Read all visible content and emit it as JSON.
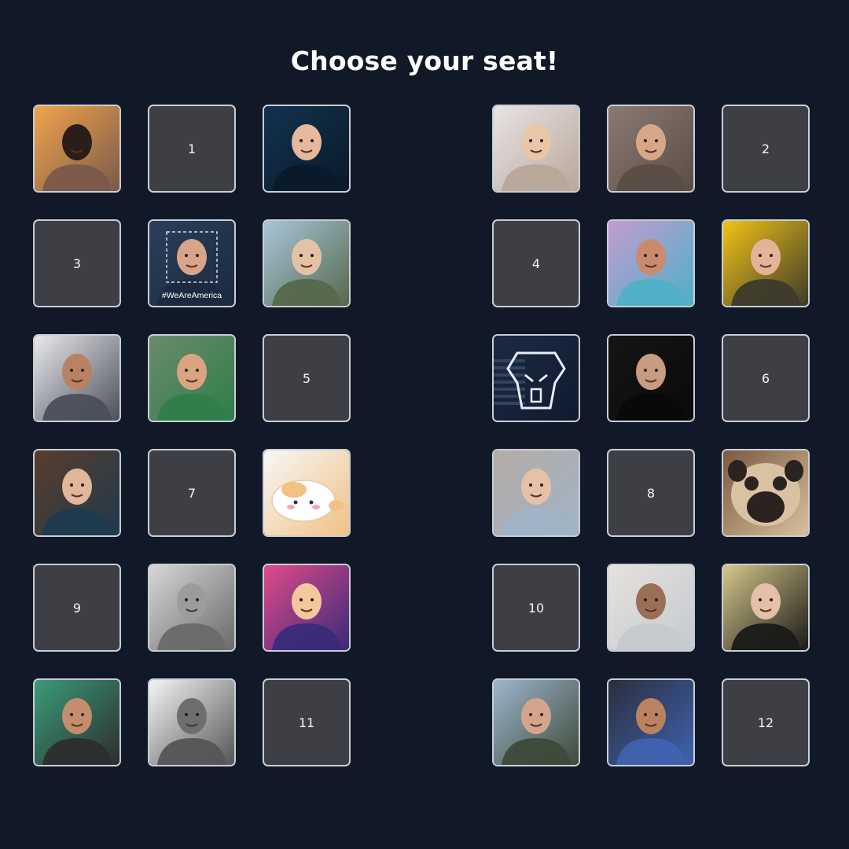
{
  "title": "Choose your seat!",
  "seats": [
    {
      "status": "taken",
      "avatar": "sunset-beach-woman-avatar",
      "colors": {
        "bg1": "#f0a34c",
        "bg2": "#7a5a4a",
        "fg": "#2a1d1a"
      }
    },
    {
      "status": "empty",
      "label": "1"
    },
    {
      "status": "taken",
      "avatar": "bald-bearded-man-avatar",
      "colors": {
        "bg1": "#12324f",
        "bg2": "#0a1a2a",
        "fg": "#e6b89c"
      }
    },
    {
      "status": "taken",
      "avatar": "blonde-woman-avatar",
      "colors": {
        "bg1": "#e8e3e5",
        "bg2": "#b9a79a",
        "fg": "#e8c6a8"
      }
    },
    {
      "status": "taken",
      "avatar": "smiling-man-hoodie-avatar",
      "colors": {
        "bg1": "#8a7a72",
        "bg2": "#5b4c45",
        "fg": "#d6a887"
      }
    },
    {
      "status": "empty",
      "label": "2"
    },
    {
      "status": "empty",
      "label": "3"
    },
    {
      "status": "taken",
      "avatar": "man-wearamerica-avatar",
      "colors": {
        "bg1": "#2c3e5b",
        "bg2": "#1b2a40",
        "fg": "#d9a58a"
      },
      "caption": "#WeAreAmerica"
    },
    {
      "status": "taken",
      "avatar": "man-glasses-camo-avatar",
      "colors": {
        "bg1": "#a9c6d8",
        "bg2": "#55684d",
        "fg": "#e3c3a6"
      }
    },
    {
      "status": "empty",
      "label": "4"
    },
    {
      "status": "taken",
      "avatar": "curly-hair-man-avatar",
      "colors": {
        "bg1": "#c39bd3",
        "bg2": "#4fb0c6",
        "fg": "#c98b6b"
      }
    },
    {
      "status": "taken",
      "avatar": "man-cap-yellow-avatar",
      "colors": {
        "bg1": "#f2c316",
        "bg2": "#3c3a2b",
        "fg": "#e3b49a"
      }
    },
    {
      "status": "taken",
      "avatar": "man-gray-hoodie-avatar",
      "colors": {
        "bg1": "#e9e9ec",
        "bg2": "#4a4f59",
        "fg": "#b98262"
      }
    },
    {
      "status": "taken",
      "avatar": "man-opentowork-avatar",
      "colors": {
        "bg1": "#6b8b6b",
        "bg2": "#2f7d4a",
        "fg": "#d9a480"
      }
    },
    {
      "status": "empty",
      "label": "5"
    },
    {
      "status": "taken",
      "avatar": "robot-flag-logo-avatar",
      "colors": {
        "bg1": "#1b2a44",
        "bg2": "#0f1a2e",
        "fg": "#e8edf5"
      }
    },
    {
      "status": "taken",
      "avatar": "man-dark-studio-avatar",
      "colors": {
        "bg1": "#151515",
        "bg2": "#0a0a0a",
        "fg": "#c99b83"
      }
    },
    {
      "status": "empty",
      "label": "6"
    },
    {
      "status": "taken",
      "avatar": "bald-man-black-shirt-avatar",
      "colors": {
        "bg1": "#5a3d2a",
        "bg2": "#1d3a4f",
        "fg": "#e1b79c"
      }
    },
    {
      "status": "empty",
      "label": "7"
    },
    {
      "status": "taken",
      "avatar": "cartoon-cat-avatar",
      "colors": {
        "bg1": "#f7f7f7",
        "bg2": "#f1c185",
        "fg": "#ffffff"
      }
    },
    {
      "status": "taken",
      "avatar": "man-hair-bun-avatar",
      "colors": {
        "bg1": "#b6aca4",
        "bg2": "#9fb3c7",
        "fg": "#e6c1a8"
      }
    },
    {
      "status": "empty",
      "label": "8"
    },
    {
      "status": "taken",
      "avatar": "pug-dog-avatar",
      "colors": {
        "bg1": "#7a5a42",
        "bg2": "#d9c09a",
        "fg": "#2b2320"
      }
    },
    {
      "status": "empty",
      "label": "9"
    },
    {
      "status": "taken",
      "avatar": "man-grayscale-avatar",
      "colors": {
        "bg1": "#d7d7d7",
        "bg2": "#6a6a6a",
        "fg": "#9c9c9c"
      }
    },
    {
      "status": "taken",
      "avatar": "cartoon-sunglasses-avatar",
      "colors": {
        "bg1": "#e04a8a",
        "bg2": "#3a2a7a",
        "fg": "#f2c89c"
      }
    },
    {
      "status": "empty",
      "label": "10"
    },
    {
      "status": "taken",
      "avatar": "man-suit-beard-avatar",
      "colors": {
        "bg1": "#e5e2dd",
        "bg2": "#c5c9cf",
        "fg": "#9b6f56"
      }
    },
    {
      "status": "taken",
      "avatar": "woman-long-hair-avatar",
      "colors": {
        "bg1": "#d6c78a",
        "bg2": "#1a1a1a",
        "fg": "#e4c0a8"
      }
    },
    {
      "status": "taken",
      "avatar": "man-cap-gesture-avatar",
      "colors": {
        "bg1": "#3a9b7a",
        "bg2": "#2d2d2d",
        "fg": "#c48d6d"
      }
    },
    {
      "status": "taken",
      "avatar": "bald-man-smiling-bw-avatar",
      "colors": {
        "bg1": "#f5f5f5",
        "bg2": "#555555",
        "fg": "#6e6e6e"
      }
    },
    {
      "status": "empty",
      "label": "11"
    },
    {
      "status": "taken",
      "avatar": "man-hoodie-outdoor-avatar",
      "colors": {
        "bg1": "#9db6cc",
        "bg2": "#3d4a3a",
        "fg": "#d4a48c"
      }
    },
    {
      "status": "taken",
      "avatar": "young-man-blue-shirt-avatar",
      "colors": {
        "bg1": "#2b2f3d",
        "bg2": "#3f62b0",
        "fg": "#b98360"
      }
    },
    {
      "status": "empty",
      "label": "12"
    }
  ]
}
